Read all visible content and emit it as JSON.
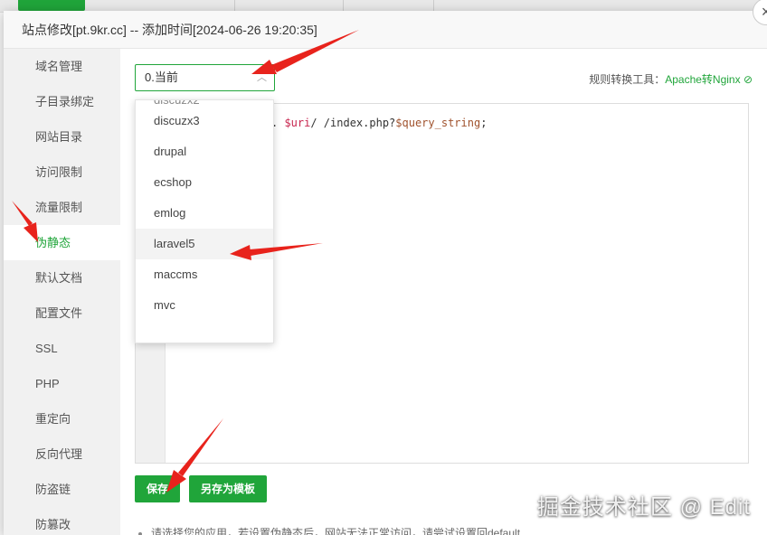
{
  "modal": {
    "title": "站点修改[pt.9kr.cc] -- 添加时间[2024-06-26 19:20:35]",
    "close": "×"
  },
  "sidebar": {
    "items": [
      {
        "label": "域名管理"
      },
      {
        "label": "子目录绑定"
      },
      {
        "label": "网站目录"
      },
      {
        "label": "访问限制"
      },
      {
        "label": "流量限制"
      },
      {
        "label": "伪静态"
      },
      {
        "label": "默认文档"
      },
      {
        "label": "配置文件"
      },
      {
        "label": "SSL"
      },
      {
        "label": "PHP"
      },
      {
        "label": "重定向"
      },
      {
        "label": "反向代理"
      },
      {
        "label": "防盗链"
      },
      {
        "label": "防篡改"
      }
    ],
    "active_index": 5
  },
  "rewrite": {
    "select_value": "0.当前",
    "tool_label": "规则转换工具：",
    "tool_link": "Apache转Nginx",
    "code_prefix": ". ",
    "code_var1": "$uri",
    "code_mid": "/ /index.php?",
    "code_var2": "$query_string",
    "code_end": ";"
  },
  "dropdown": {
    "options": [
      "discuzx3",
      "drupal",
      "ecshop",
      "emlog",
      "laravel5",
      "maccms",
      "mvc"
    ],
    "hovered": "laravel5"
  },
  "buttons": {
    "save": "保存",
    "save_template": "另存为模板"
  },
  "tip": "请选择您的应用，若设置伪静态后，网站无法正常访问，请尝试设置回default",
  "watermark": "掘金技术社区 @ Edit",
  "colors": {
    "accent": "#20a53a",
    "arrow": "#e8231c"
  }
}
